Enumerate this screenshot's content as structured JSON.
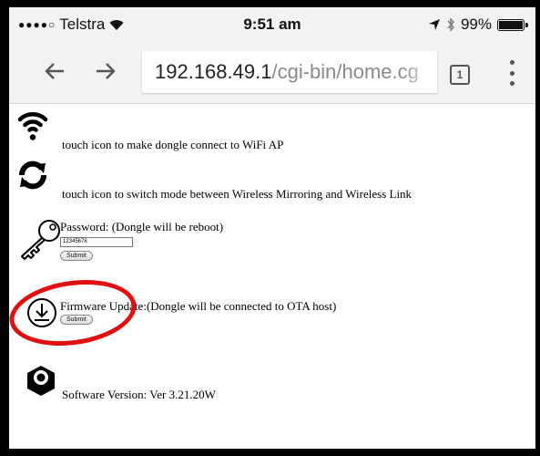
{
  "status_bar": {
    "carrier": "Telstra",
    "signal_dots": "●●●●○",
    "time": "9:51 am",
    "battery": "99%"
  },
  "browser": {
    "url_host": "192.168.49.1",
    "url_path": "/cgi-bin/home.cg",
    "tab_count": "1"
  },
  "page": {
    "wifi_text": "touch icon to make dongle connect to WiFi AP",
    "mode_text": "touch icon to switch mode between Wireless Mirroring and Wireless Link",
    "password_label": "Password: (Dongle will be reboot)",
    "password_value": "12345678",
    "password_submit": "Submit",
    "firmware_label": "Firmware Update:(Dongle will be connected to OTA host)",
    "firmware_submit": "Submit",
    "software_version": "Software Version: Ver 3.21.20W"
  },
  "colors": {
    "highlight": "#e01010",
    "chrome_bg": "#f2f2f2"
  }
}
